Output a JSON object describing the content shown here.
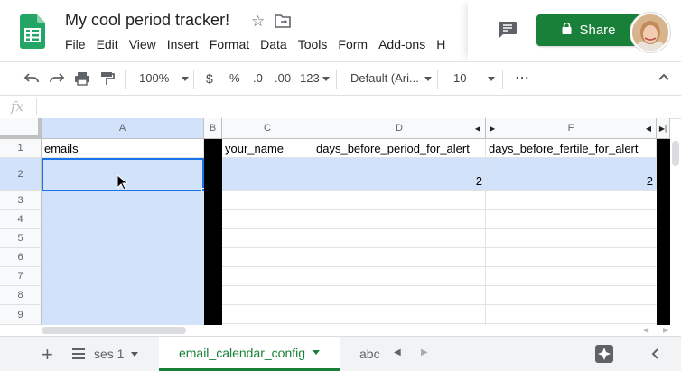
{
  "app": {
    "title": "My cool period tracker!",
    "menu": [
      "File",
      "Edit",
      "View",
      "Insert",
      "Format",
      "Data",
      "Tools",
      "Form",
      "Add-ons",
      "H"
    ],
    "share_label": "Share"
  },
  "toolbar": {
    "zoom": "100%",
    "currency": "$",
    "percent": "%",
    "dec_less": ".0",
    "dec_more": ".00",
    "more_formats": "123",
    "font": "Default (Ari...",
    "font_size": "10",
    "more": "⋯"
  },
  "formula": {
    "fx": "fx",
    "value": ""
  },
  "columns": [
    "A",
    "B",
    "C",
    "D",
    "F"
  ],
  "rows": [
    "1",
    "2",
    "3",
    "4",
    "5",
    "6",
    "7",
    "8",
    "9"
  ],
  "cells": {
    "A1": "emails",
    "C1": "your_name",
    "D1": "days_before_period_for_alert",
    "F1": "days_before_fertile_for_alert",
    "D2": "2",
    "F2": "2"
  },
  "sheets": {
    "left": "ses 1",
    "active": "email_calendar_config",
    "right": "abc"
  },
  "colors": {
    "accent": "#188038",
    "selection": "#d3e2fb"
  }
}
